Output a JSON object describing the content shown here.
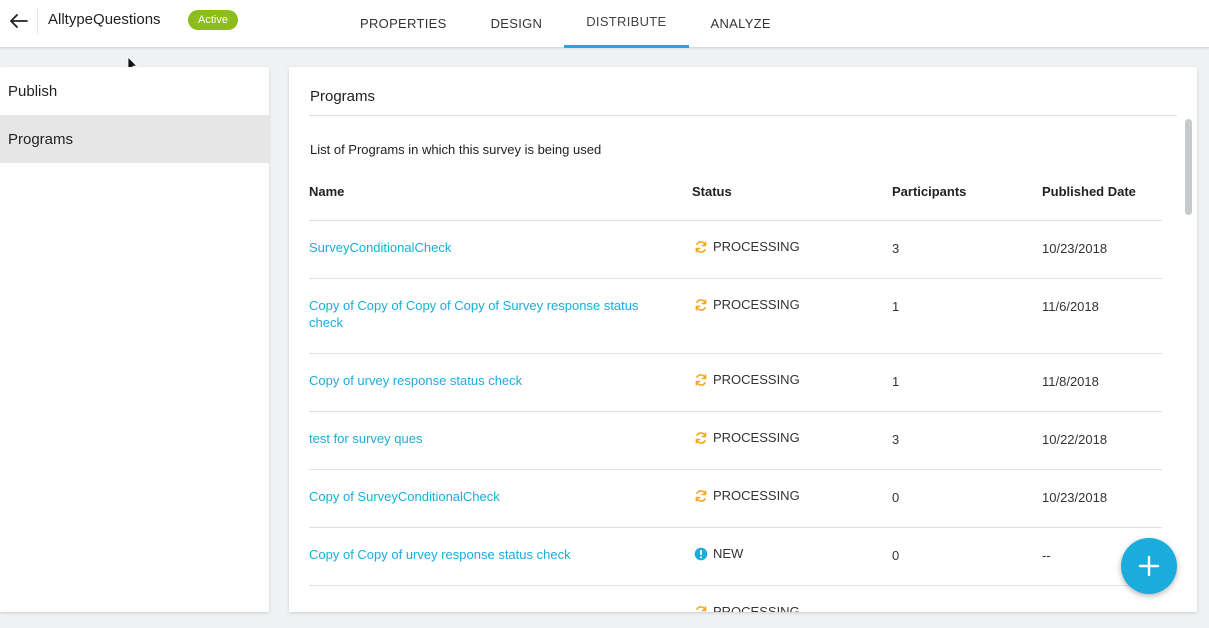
{
  "header": {
    "title": "AlltypeQuestions",
    "status_badge": "Active",
    "tabs": [
      {
        "label": "PROPERTIES"
      },
      {
        "label": "DESIGN"
      },
      {
        "label": "DISTRIBUTE"
      },
      {
        "label": "ANALYZE"
      }
    ],
    "active_tab": "DISTRIBUTE"
  },
  "sidebar": {
    "items": [
      {
        "label": "Publish"
      },
      {
        "label": "Programs"
      }
    ],
    "selected": "Programs"
  },
  "panel": {
    "title": "Programs",
    "description": "List of Programs in which this survey is being used",
    "columns": [
      "Name",
      "Status",
      "Participants",
      "Published Date"
    ],
    "rows": [
      {
        "name": "SurveyConditionalCheck",
        "status": "PROCESSING",
        "participants": "3",
        "date": "10/23/2018"
      },
      {
        "name": "Copy of Copy of Copy of Copy of Survey response status check",
        "status": "PROCESSING",
        "participants": "1",
        "date": "11/6/2018"
      },
      {
        "name": "Copy of urvey response status check",
        "status": "PROCESSING",
        "participants": "1",
        "date": "11/8/2018"
      },
      {
        "name": "test for survey ques",
        "status": "PROCESSING",
        "participants": "3",
        "date": "10/22/2018"
      },
      {
        "name": "Copy of SurveyConditionalCheck",
        "status": "PROCESSING",
        "participants": "0",
        "date": "10/23/2018"
      },
      {
        "name": "Copy of Copy of urvey response status check",
        "status": "NEW",
        "participants": "0",
        "date": "--"
      },
      {
        "name": "",
        "status": "PROCESSING",
        "participants": "",
        "date": ""
      }
    ]
  },
  "icons": {
    "back": "arrow-left-icon",
    "processing": "sync-icon",
    "new": "info-icon",
    "fab": "plus-icon"
  },
  "colors": {
    "accent": "#1aaddb",
    "active_badge": "#8cbd1b",
    "processing": "#f5a623",
    "new": "#1aaddb"
  }
}
